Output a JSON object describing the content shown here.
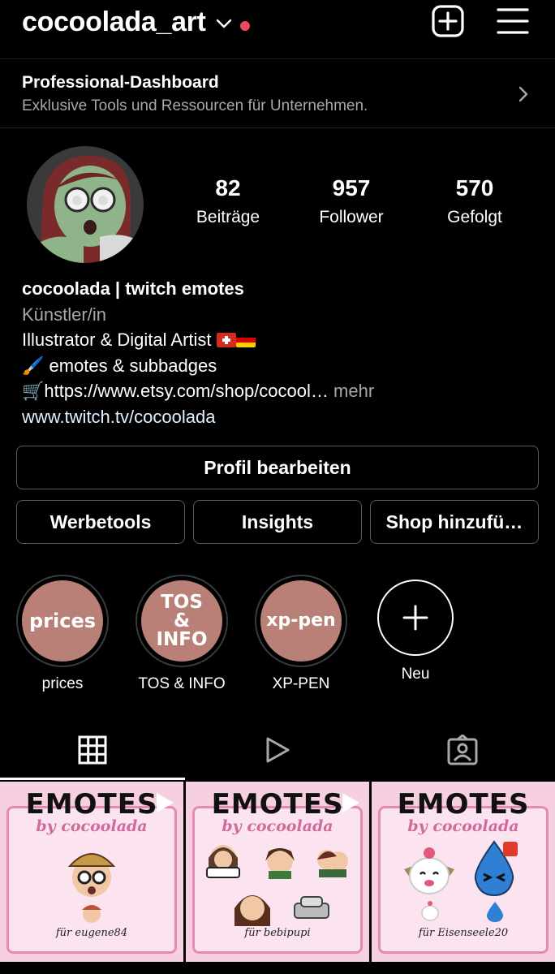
{
  "header": {
    "username": "cocoolada_art"
  },
  "dashboard": {
    "title": "Professional-Dashboard",
    "subtitle": "Exklusive Tools und Ressourcen für Unternehmen."
  },
  "stats": [
    {
      "value": "82",
      "label": "Beiträge"
    },
    {
      "value": "957",
      "label": "Follower"
    },
    {
      "value": "570",
      "label": "Gefolgt"
    }
  ],
  "bio": {
    "name": "cocoolada | twitch emotes",
    "category": "Künstler/in",
    "line1": "Illustrator & Digital Artist",
    "line2": "🖌️ emotes & subbadges",
    "line3_url": "🛒https://www.etsy.com/shop/cocool…",
    "line3_more": "mehr",
    "website": "www.twitch.tv/cocoolada"
  },
  "buttons": {
    "edit_profile": "Profil bearbeiten",
    "ad_tools": "Werbetools",
    "insights": "Insights",
    "add_shop": "Shop hinzufü…"
  },
  "highlights": [
    {
      "cover": "prices",
      "label": "prices"
    },
    {
      "cover": "TOS & INFO",
      "label": "TOS & INFO"
    },
    {
      "cover": "xp-pen",
      "label": "XP-PEN"
    }
  ],
  "new_highlight_label": "Neu",
  "tabs": [
    {
      "icon": "grid-icon"
    },
    {
      "icon": "reels-icon"
    },
    {
      "icon": "tagged-icon"
    }
  ],
  "posts": [
    {
      "title": "EMOTES",
      "by": "by cocoolada",
      "for": "für eugene84"
    },
    {
      "title": "EMOTES",
      "by": "by cocoolada",
      "for": "für bebipupi"
    },
    {
      "title": "EMOTES",
      "by": "by cocoolada",
      "for": "für Eisenseele20"
    }
  ],
  "colors": {
    "background": "#000000",
    "notification_dot": "#ef4a5c",
    "highlight_cover": "#b98078",
    "post_pink": "#f6cfe1"
  }
}
